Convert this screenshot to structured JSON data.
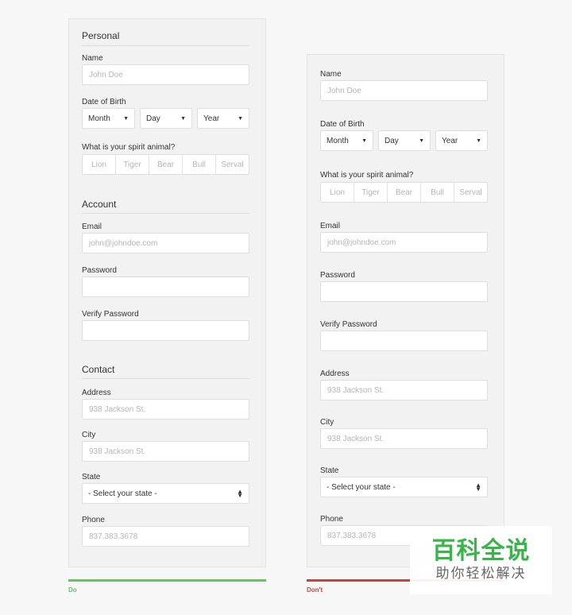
{
  "do_form": {
    "personal": {
      "title": "Personal",
      "name_label": "Name",
      "name_placeholder": "John Doe",
      "dob_label": "Date of Birth",
      "month": "Month",
      "day": "Day",
      "year": "Year",
      "spirit_label": "What is your spirit animal?",
      "animals": [
        "Lion",
        "Tiger",
        "Bear",
        "Bull",
        "Serval"
      ]
    },
    "account": {
      "title": "Account",
      "email_label": "Email",
      "email_placeholder": "john@johndoe.com",
      "password_label": "Password",
      "verify_label": "Verify Password"
    },
    "contact": {
      "title": "Contact",
      "address_label": "Address",
      "address_placeholder": "938 Jackson St.",
      "city_label": "City",
      "city_placeholder": "938 Jackson St.",
      "state_label": "State",
      "state_value": "- Select your state -",
      "phone_label": "Phone",
      "phone_placeholder": "837.383.3678"
    },
    "caption": "Do",
    "bar_color": "#6bbf6b"
  },
  "dont_form": {
    "name_label": "Name",
    "name_placeholder": "John Doe",
    "dob_label": "Date of Birth",
    "month": "Month",
    "day": "Day",
    "year": "Year",
    "spirit_label": "What is your spirit animal?",
    "animals": [
      "Lion",
      "Tiger",
      "Bear",
      "Bull",
      "Serval"
    ],
    "email_label": "Email",
    "email_placeholder": "john@johndoe.com",
    "password_label": "Password",
    "verify_label": "Verify Password",
    "address_label": "Address",
    "address_placeholder": "938 Jackson St.",
    "city_label": "City",
    "city_placeholder": "938 Jackson St.",
    "state_label": "State",
    "state_value": "- Select your state -",
    "phone_label": "Phone",
    "phone_placeholder": "837.383.3678",
    "caption": "Don't",
    "bar_color": "#b84a42"
  },
  "watermark": {
    "logo": "百科全说",
    "sub": "助你轻松解决"
  }
}
